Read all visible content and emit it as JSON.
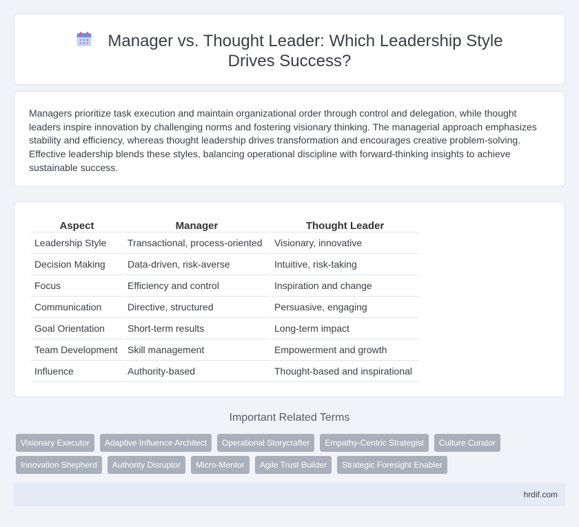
{
  "header": {
    "icon": "calendar-icon",
    "title": "Manager vs. Thought Leader: Which Leadership Style Drives Success?"
  },
  "intro": {
    "text": "Managers prioritize task execution and maintain organizational order through control and delegation, while thought leaders inspire innovation by challenging norms and fostering visionary thinking. The managerial approach emphasizes stability and efficiency, whereas thought leadership drives transformation and encourages creative problem-solving. Effective leadership blends these styles, balancing operational discipline with forward-thinking insights to achieve sustainable success."
  },
  "table": {
    "headers": [
      "Aspect",
      "Manager",
      "Thought Leader"
    ],
    "rows": [
      [
        "Leadership Style",
        "Transactional, process-oriented",
        "Visionary, innovative"
      ],
      [
        "Decision Making",
        "Data-driven, risk-averse",
        "Intuitive, risk-taking"
      ],
      [
        "Focus",
        "Efficiency and control",
        "Inspiration and change"
      ],
      [
        "Communication",
        "Directive, structured",
        "Persuasive, engaging"
      ],
      [
        "Goal Orientation",
        "Short-term results",
        "Long-term impact"
      ],
      [
        "Team Development",
        "Skill management",
        "Empowerment and growth"
      ],
      [
        "Influence",
        "Authority-based",
        "Thought-based and inspirational"
      ]
    ]
  },
  "related": {
    "title": "Important Related Terms",
    "rows": [
      [
        "Visionary Executor",
        "Adaptive Influence Architect",
        "Operational Storycrafter",
        "Empathy-Centric Strategist",
        "Culture Curator"
      ],
      [
        "Innovation Shepherd",
        "Authority Disruptor",
        "Micro-Mentor",
        "Agile Trust Builder",
        "Strategic Foresight Enabler"
      ]
    ]
  },
  "footer": {
    "site": "hrdif.com"
  },
  "colors": {
    "background": "#f0f3f8",
    "tag": "#a9b0ba",
    "footer": "#e5ebf5"
  }
}
